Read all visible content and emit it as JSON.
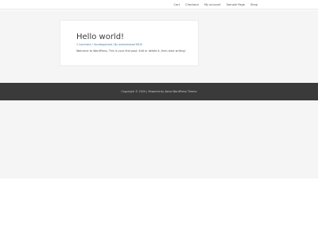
{
  "header": {
    "nav": [
      "Cart",
      "Checkout",
      "My account",
      "Sample Page",
      "Shop"
    ]
  },
  "post": {
    "title": "Hello world!",
    "meta": {
      "comments": "1 Comment",
      "category": "Uncategorized",
      "author": "By onehomesterTI610"
    },
    "excerpt": "Welcome to WordPress. This is your first post. Edit or delete it, then start writing!"
  },
  "footer": {
    "text": "Copyright © 2020 | Powered by Astra WordPress Theme"
  },
  "colors": {
    "footer_bg": "#3a3a3a",
    "content_bg": "#f5f5f5",
    "link": "#3a7bb8"
  }
}
